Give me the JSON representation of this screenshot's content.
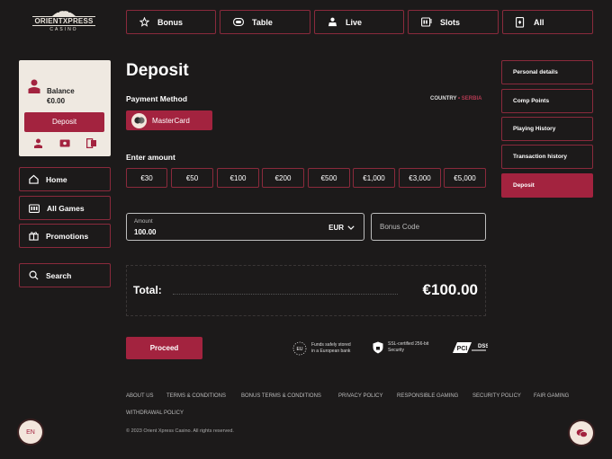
{
  "logo": {
    "name": "ORIENTXPRESS",
    "sub": "CASINO"
  },
  "topnav": [
    {
      "label": "Bonus",
      "icon": "star-icon"
    },
    {
      "label": "Table",
      "icon": "poker-chip-icon"
    },
    {
      "label": "Live",
      "icon": "live-dealer-icon"
    },
    {
      "label": "Slots",
      "icon": "slots-icon"
    },
    {
      "label": "All",
      "icon": "cards-icon"
    }
  ],
  "balance": {
    "label": "Balance",
    "amount": "€0.00",
    "deposit_label": "Deposit"
  },
  "sidebar": {
    "items": [
      {
        "label": "Home",
        "icon": "home-icon"
      },
      {
        "label": "All Games",
        "icon": "games-icon"
      },
      {
        "label": "Promotions",
        "icon": "gift-icon"
      }
    ],
    "search_label": "Search"
  },
  "page": {
    "title": "Deposit",
    "payment_method_label": "Payment Method",
    "country_label": "COUNTRY",
    "country_value": "SERBIA",
    "payment_method": "MasterCard",
    "enter_amount_label": "Enter amount",
    "amount_presets": [
      "€30",
      "€50",
      "€100",
      "€200",
      "€500",
      "€1,000",
      "€3,000",
      "€5,000"
    ],
    "amount_field_label": "Amount",
    "amount_value": "100.00",
    "currency": "EUR",
    "bonus_placeholder": "Bonus Code",
    "total_label": "Total:",
    "total_value": "€100.00",
    "proceed_label": "Proceed",
    "trust": [
      {
        "line1": "Funds safely stored",
        "line2": "in a European bank",
        "badge": "EU"
      },
      {
        "line1": "SSL-certified 256-bit",
        "line2": "Security"
      },
      {
        "badge": "PCI DSS"
      }
    ]
  },
  "account_menu": [
    {
      "label": "Personal details",
      "active": false
    },
    {
      "label": "Comp Points",
      "active": false
    },
    {
      "label": "Playing History",
      "active": false
    },
    {
      "label": "Transaction history",
      "active": false
    },
    {
      "label": "Deposit",
      "active": true
    }
  ],
  "footer": {
    "links": [
      "ABOUT US",
      "TERMS & CONDITIONS",
      "BONUS TERMS & CONDITIONS",
      "PRIVACY POLICY",
      "RESPONSIBLE GAMING",
      "SECURITY POLICY",
      "FAIR GAMING",
      "WITHDRAWAL POLICY"
    ],
    "copyright": "© 2023 Orient Xpress Casino. All rights reserved.",
    "language": "EN"
  },
  "colors": {
    "accent": "#a3233f",
    "background": "#1c1a1a",
    "card": "#efe9e1"
  }
}
